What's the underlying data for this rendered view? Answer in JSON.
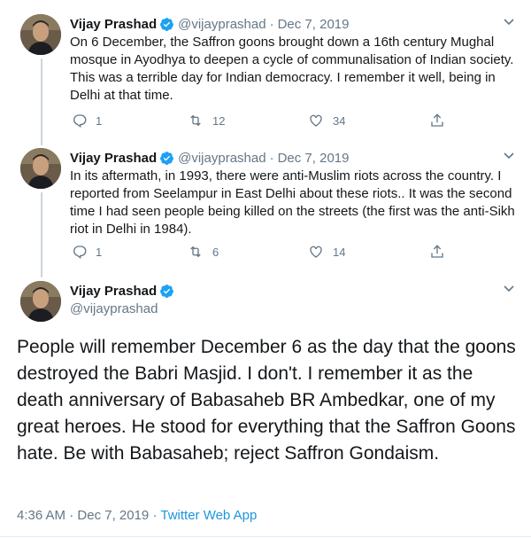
{
  "tweets": [
    {
      "name": "Vijay Prashad",
      "handle": "@vijayprashad",
      "separator": "·",
      "date": "Dec 7, 2019",
      "text": "On 6 December, the Saffron goons brought down a 16th century Mughal mosque in Ayodhya to deepen a cycle of communalisation of Indian society. This was a terrible day for Indian democracy. I remember it well, being in Delhi at that time.",
      "replies": "1",
      "retweets": "12",
      "likes": "34"
    },
    {
      "name": "Vijay Prashad",
      "handle": "@vijayprashad",
      "separator": "·",
      "date": "Dec 7, 2019",
      "text": "In its aftermath, in 1993, there were anti-Muslim riots across the country. I reported from Seelampur in East Delhi about these riots.. It was the second time I had seen people being killed on the streets (the first was the anti-Sikh riot in Delhi in 1984).",
      "replies": "1",
      "retweets": "6",
      "likes": "14"
    }
  ],
  "main_tweet": {
    "name": "Vijay Prashad",
    "handle": "@vijayprashad",
    "text": "People will remember December 6 as the day that the goons destroyed the Babri Masjid. I don't. I remember it as the death anniversary of Babasaheb BR Ambedkar, one of my great heroes. He stood for everything that the Saffron Goons hate. Be with Babasaheb; reject Saffron Gondaism.",
    "time": "4:36 AM",
    "separator": "·",
    "date": "Dec 7, 2019",
    "separator2": "·",
    "source": "Twitter Web App"
  },
  "colors": {
    "verified": "#1da1f2",
    "link": "#1b95e0",
    "secondary_text": "#657786",
    "thread_line": "#ccd6dd"
  },
  "icons": {
    "reply": "reply-icon",
    "retweet": "retweet-icon",
    "like": "like-icon",
    "share": "share-icon",
    "verified": "verified-badge-icon",
    "caret": "chevron-down-icon"
  }
}
